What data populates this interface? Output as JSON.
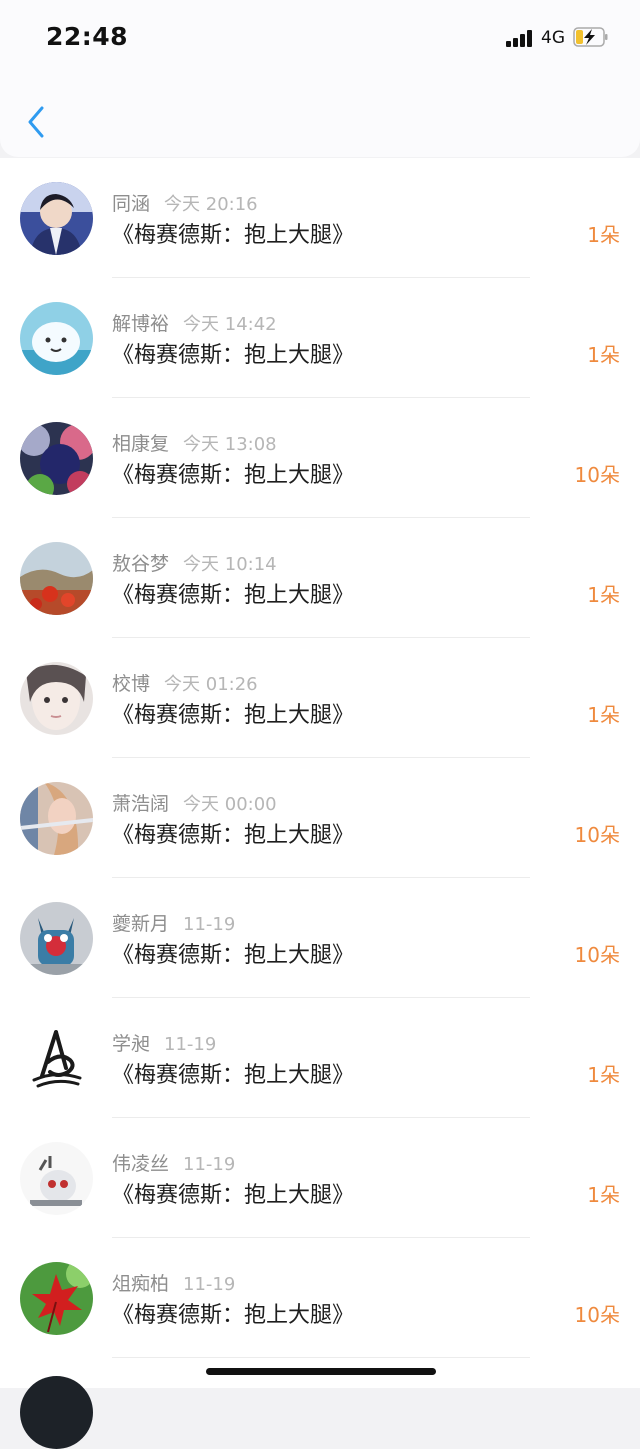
{
  "status_bar": {
    "time": "22:48",
    "network": "4G"
  },
  "icons": {
    "back": "chevron-left-icon",
    "signal": "signal-bars-icon",
    "battery": "battery-charging-icon"
  },
  "colors": {
    "accent": "#2f9bf0",
    "amount": "#ef8a3e",
    "name": "#8e8e8e",
    "time": "#b6b6b6"
  },
  "gifts": [
    {
      "name": "同涵",
      "time": "今天 20:16",
      "title": "《梅赛德斯：抱上大腿》",
      "amount": "1朵"
    },
    {
      "name": "解博裕",
      "time": "今天 14:42",
      "title": "《梅赛德斯：抱上大腿》",
      "amount": "1朵"
    },
    {
      "name": "相康复",
      "time": "今天 13:08",
      "title": "《梅赛德斯：抱上大腿》",
      "amount": "10朵"
    },
    {
      "name": "敖谷梦",
      "time": "今天 10:14",
      "title": "《梅赛德斯：抱上大腿》",
      "amount": "1朵"
    },
    {
      "name": "校博",
      "time": "今天 01:26",
      "title": "《梅赛德斯：抱上大腿》",
      "amount": "1朵"
    },
    {
      "name": "萧浩阔",
      "time": "今天 00:00",
      "title": "《梅赛德斯：抱上大腿》",
      "amount": "10朵"
    },
    {
      "name": "夔新月",
      "time": "11-19",
      "title": "《梅赛德斯：抱上大腿》",
      "amount": "10朵"
    },
    {
      "name": "学昶",
      "time": "11-19",
      "title": "《梅赛德斯：抱上大腿》",
      "amount": "1朵"
    },
    {
      "name": "伟凌丝",
      "time": "11-19",
      "title": "《梅赛德斯：抱上大腿》",
      "amount": "1朵"
    },
    {
      "name": "俎痴柏",
      "time": "11-19",
      "title": "《梅赛德斯：抱上大腿》",
      "amount": "10朵"
    }
  ]
}
